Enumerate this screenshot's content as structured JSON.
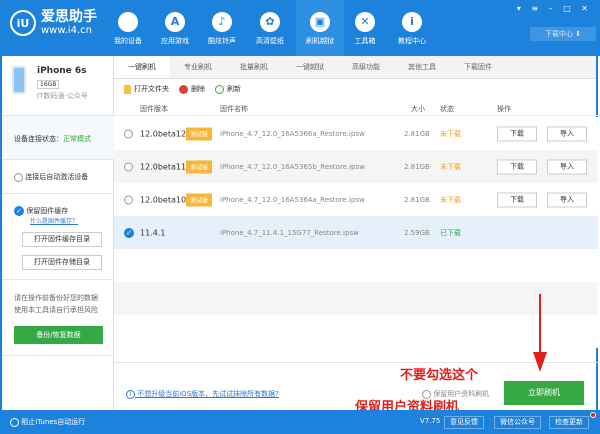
{
  "app": {
    "logo_icon": "i4-logo",
    "name": "爱思助手",
    "url": "www.i4.cn",
    "accent": "#1d82dc"
  },
  "nav": [
    {
      "label": "我的设备",
      "icon": "apple-icon"
    },
    {
      "label": "应用游戏",
      "icon": "appstore-icon"
    },
    {
      "label": "酷炫铃声",
      "icon": "bell-icon"
    },
    {
      "label": "高清壁纸",
      "icon": "flower-icon"
    },
    {
      "label": "刷机越狱",
      "icon": "box-icon",
      "active": true
    },
    {
      "label": "工具箱",
      "icon": "tools-icon"
    },
    {
      "label": "教程中心",
      "icon": "info-icon"
    }
  ],
  "download_center": "下载中心 ⬇",
  "device": {
    "name": "iPhone 6s",
    "capacity": "16GB",
    "owner": "IT数码通-公众号"
  },
  "sidebar": {
    "status_label": "设备连接状态：",
    "status_value": "正常模式",
    "auto_activate": "连接后自动激活设备",
    "keep_cache": "保留固件缓存",
    "what_cache": "什么是固件缓存？",
    "open_cache_dir": "打开固件缓存目录",
    "open_store_dir": "打开固件存储目录",
    "warning1": "请在操作前备份好您的数据",
    "warning2": "使用本工具请自行承担风险",
    "backup_btn": "备份/恢复数据"
  },
  "tabs": [
    "一键刷机",
    "专业刷机",
    "批量刷机",
    "一键越狱",
    "高级功能",
    "其他工具",
    "下载固件"
  ],
  "toolbar": {
    "open_folder": "打开文件夹",
    "delete": "删除",
    "refresh": "刷新"
  },
  "table": {
    "headers": {
      "version": "固件版本",
      "name": "固件名称",
      "size": "大小",
      "status": "状态",
      "action": "操作"
    },
    "rows": [
      {
        "version": "12.0beta12",
        "tag": "测试版",
        "name": "iPhone_4.7_12.0_16A5366a_Restore.ipsw",
        "size": "2.81GB",
        "status": "未下载",
        "selected": false,
        "btn1": "下载",
        "btn2": "导入"
      },
      {
        "version": "12.0beta11",
        "tag": "测试版",
        "name": "iPhone_4.7_12.0_16A5365b_Restore.ipsw",
        "size": "2.81GB",
        "status": "未下载",
        "selected": false,
        "btn1": "下载",
        "btn2": "导入"
      },
      {
        "version": "12.0beta10",
        "tag": "测试版",
        "name": "iPhone_4.7_12.0_16A5364a_Restore.ipsw",
        "size": "2.81GB",
        "status": "未下载",
        "selected": false,
        "btn1": "下载",
        "btn2": "导入"
      },
      {
        "version": "11.4.1",
        "tag": "",
        "name": "iPhone_4.7_11.4.1_15G77_Restore.ipsw",
        "size": "2.59GB",
        "status": "已下载",
        "selected": true
      }
    ]
  },
  "bottom": {
    "link": "不想升级当前iOS版本，先试试抹除所有数据?",
    "keep_data": "保留用户资料刷机",
    "flash_btn": "立即刷机"
  },
  "annotations": {
    "top": "不要勾选这个",
    "bottom": "保留用户资料刷机"
  },
  "statusbar": {
    "itunes": "阻止iTunes自动运行",
    "version": "V7.75",
    "feedback": "意见反馈",
    "wechat": "微信公众号",
    "update": "检查更新"
  }
}
